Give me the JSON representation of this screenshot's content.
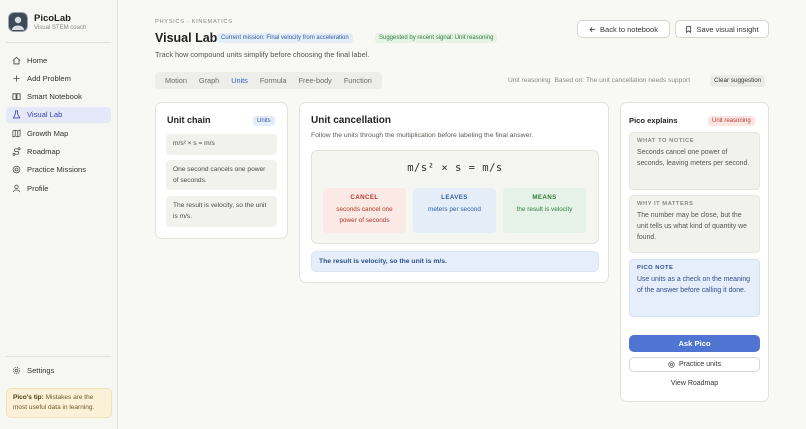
{
  "brand": {
    "name": "PicoLab",
    "subtitle": "Visual STEM coach"
  },
  "sidebar": {
    "items": [
      {
        "label": "Home",
        "icon": "home-icon"
      },
      {
        "label": "Add Problem",
        "icon": "plus-icon"
      },
      {
        "label": "Smart Notebook",
        "icon": "book-icon"
      },
      {
        "label": "Visual Lab",
        "icon": "flask-icon",
        "active": true
      },
      {
        "label": "Growth Map",
        "icon": "map-icon"
      },
      {
        "label": "Roadmap",
        "icon": "route-icon"
      },
      {
        "label": "Practice Missions",
        "icon": "target-icon"
      },
      {
        "label": "Profile",
        "icon": "user-icon"
      }
    ],
    "settings_label": "Settings",
    "tip_label": "Pico's tip:",
    "tip_text": "Mistakes are the most useful data in learning."
  },
  "header": {
    "breadcrumb": "PHYSICS · KINEMATICS",
    "title": "Visual Lab",
    "mission_pill": "Current mission: Final velocity from acceleration",
    "suggest_pill": "Suggested by recent signal: Unit reasoning",
    "description": "Track how compound units simplify before choosing the final label.",
    "back_label": "Back to notebook",
    "save_label": "Save visual insight"
  },
  "tabs": [
    {
      "label": "Motion"
    },
    {
      "label": "Graph"
    },
    {
      "label": "Units",
      "active": true
    },
    {
      "label": "Formula"
    },
    {
      "label": "Free-body"
    },
    {
      "label": "Function"
    }
  ],
  "suggestion": {
    "reason": "Unit reasoning",
    "based_on": "Based on: The unit cancellation needs support",
    "clear_label": "Clear suggestion"
  },
  "unit_chain": {
    "title": "Unit chain",
    "badge": "Units",
    "steps": [
      "m/s² × s = m/s",
      "One second cancels one power of seconds.",
      "The result is velocity, so the unit is m/s."
    ]
  },
  "unit_cancellation": {
    "title": "Unit cancellation",
    "description": "Follow the units through the multiplication before labeling the final answer.",
    "equation": "m/s² × s = m/s",
    "cancel": {
      "heading": "CANCEL",
      "text": "seconds cancel one power of seconds"
    },
    "leaves": {
      "heading": "LEAVES",
      "text": "meters per second"
    },
    "means": {
      "heading": "MEANS",
      "text": "the result is velocity"
    },
    "result": "The result is velocity, so the unit is m/s."
  },
  "pico": {
    "title": "Pico explains",
    "badge": "Unit reasoning",
    "notice": {
      "heading": "WHAT TO NOTICE",
      "text": "Seconds cancel one power of seconds, leaving meters per second."
    },
    "matters": {
      "heading": "WHY IT MATTERS",
      "text": "The number may be close, but the unit tells us what kind of quantity we found."
    },
    "note": {
      "heading": "PICO NOTE",
      "text": "Use units as a check on the meaning of the answer before calling it done."
    },
    "ask_label": "Ask Pico",
    "practice_label": "Practice units",
    "roadmap_label": "View Roadmap"
  },
  "colors": {
    "accent": "#4f74d1",
    "active_nav_bg": "#e5e8f8",
    "cancel": "#b3392c",
    "leaves": "#2f5fa3",
    "means": "#2f7d3a"
  }
}
